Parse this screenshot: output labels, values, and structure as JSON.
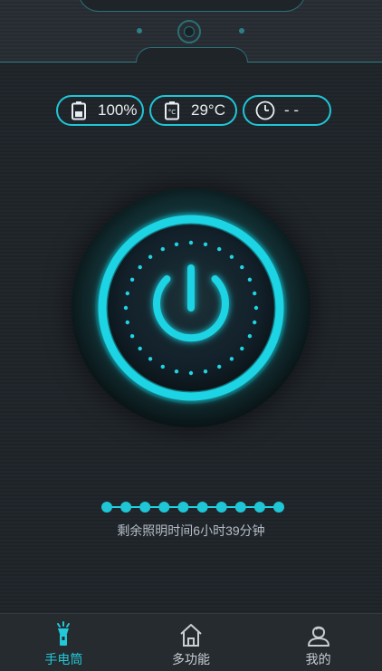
{
  "status_pills": {
    "battery": {
      "icon": "battery-icon",
      "value": "100%"
    },
    "temperature": {
      "icon": "thermometer-battery-icon",
      "icon_text": "°C",
      "value": "29°C"
    },
    "timer": {
      "icon": "clock-icon",
      "value": "- -"
    }
  },
  "power_button": {
    "icon": "power-icon",
    "state": "off"
  },
  "brightness": {
    "segments": 10,
    "level_fraction": 1.0
  },
  "remaining_text": "剩余照明时间6小时39分钟",
  "nav": {
    "items": [
      {
        "label": "手电筒",
        "icon": "flashlight-icon",
        "active": true
      },
      {
        "label": "多功能",
        "icon": "home-icon",
        "active": false
      },
      {
        "label": "我的",
        "icon": "user-icon",
        "active": false
      }
    ]
  },
  "colors": {
    "accent": "#1fc6d6",
    "background": "#22272d",
    "nav_background": "#262b30"
  }
}
